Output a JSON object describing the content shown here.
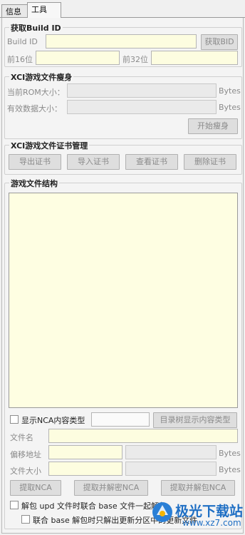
{
  "tabs": [
    {
      "label": "信息"
    },
    {
      "label": "工具"
    }
  ],
  "get_build_id": {
    "title": "获取Build ID",
    "build_id_label": "Build ID",
    "get_bid_button": "获取BID",
    "first16_label": "前16位",
    "first32_label": "前32位"
  },
  "xci_trim": {
    "title": "XCI游戏文件瘦身",
    "rom_size_label": "当前ROM大小：",
    "valid_size_label": "有效数据大小：",
    "bytes_unit": "Bytes",
    "start_button": "开始瘦身"
  },
  "cert": {
    "title": "XCI游戏文件证书管理",
    "export_button": "导出证书",
    "import_button": "导入证书",
    "view_button": "查看证书",
    "delete_button": "删除证书"
  },
  "structure": {
    "title": "游戏文件结构",
    "show_nca_label": "显示NCA内容类型",
    "tree_show_button": "目录树显示内容类型",
    "filename_label": "文件名",
    "offset_label": "偏移地址",
    "filesize_label": "文件大小",
    "bytes_unit": "Bytes",
    "extract_nca_button": "提取NCA",
    "extract_decrypt_button": "提取并解密NCA",
    "extract_unpack_button": "提取并解包NCA",
    "unpack_upd_label": "解包 upd 文件时联合 base 文件一起解包",
    "unpack_base_label": "联合 base 解包时只解出更新分区中的更新文件"
  },
  "watermark": {
    "text": "极光下载站",
    "url": "www.xz7.com"
  },
  "colors": {
    "field_yellow": "#fdfde0",
    "panel_bg": "#f4f4f4",
    "disabled_text": "#8a8a8a",
    "watermark_blue": "#1f6fc4"
  }
}
